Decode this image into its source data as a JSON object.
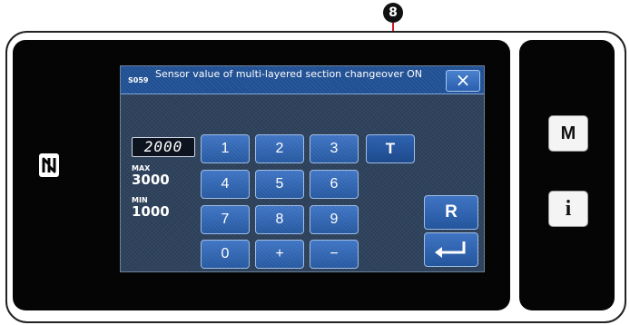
{
  "callout": {
    "number": "8"
  },
  "dialog": {
    "code": "S059",
    "title": "Sensor value of multi-layered section changeover ON",
    "close_icon": "close-icon"
  },
  "input": {
    "value": "2000",
    "max_label": "MAX",
    "max_value": "3000",
    "min_label": "MIN",
    "min_value": "1000"
  },
  "keypad": {
    "k1": "1",
    "k2": "2",
    "k3": "3",
    "kT": "T",
    "k4": "4",
    "k5": "5",
    "k6": "6",
    "k7": "7",
    "k8": "8",
    "k9": "9",
    "k0": "0",
    "kplus": "+",
    "kminus": "−",
    "reset": "R",
    "enter_icon": "enter-icon"
  },
  "side": {
    "m": "M",
    "info": "i",
    "nfc_icon": "nfc-icon"
  },
  "colors": {
    "screen_bg": "#2b3e58",
    "title_bar": "#1f4f93",
    "key": "#3566b4",
    "callout_line": "#d4182b"
  }
}
